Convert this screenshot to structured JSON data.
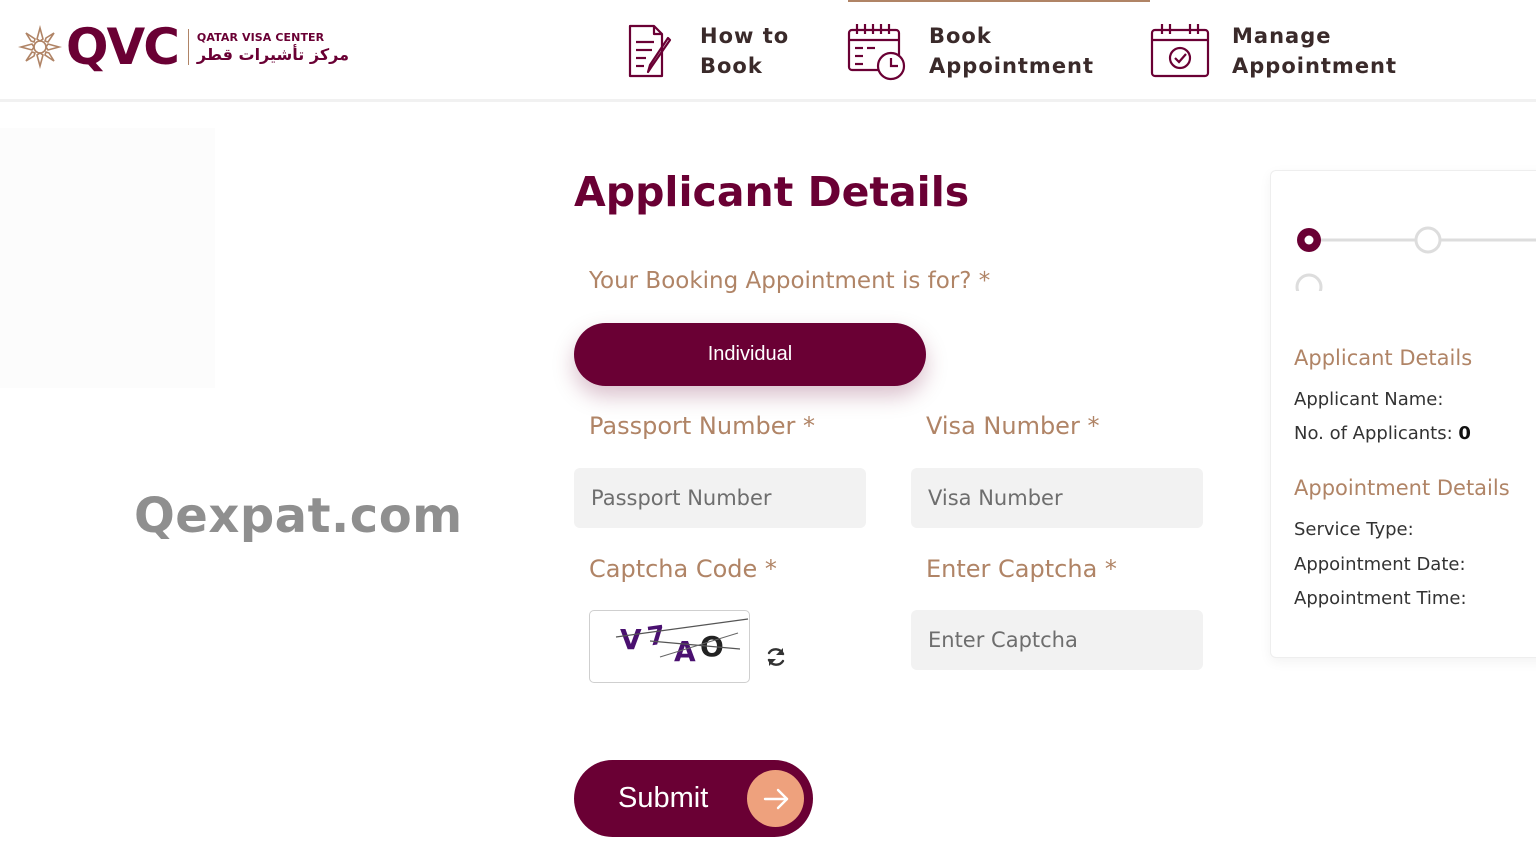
{
  "header": {
    "brand": "QVC",
    "brand_sub_en": "QATAR VISA CENTER",
    "brand_sub_ar": "مركز تأشيرات قطر",
    "nav": [
      {
        "line1": "How to",
        "line2": "Book"
      },
      {
        "line1": "Book",
        "line2": "Appointment"
      },
      {
        "line1": "Manage",
        "line2": "Appointment"
      }
    ]
  },
  "watermark": "Qexpat.com",
  "form": {
    "title": "Applicant Details",
    "question": "Your Booking Appointment is for? *",
    "individual_label": "Individual",
    "passport_label": "Passport Number *",
    "passport_placeholder": "Passport Number",
    "visa_label": "Visa Number *",
    "visa_placeholder": "Visa Number",
    "captcha_label": "Captcha Code *",
    "captcha_text": "V7AO",
    "enter_captcha_label": "Enter Captcha *",
    "enter_captcha_placeholder": "Enter Captcha",
    "submit_label": "Submit"
  },
  "summary": {
    "applicant_heading": "Applicant Details",
    "applicant_name_label": "Applicant Name:",
    "applicant_name_value": "",
    "num_applicants_label": "No. of Applicants:",
    "num_applicants_value": "0",
    "appointment_heading": "Appointment Details",
    "service_type_label": "Service Type:",
    "appointment_date_label": "Appointment Date:",
    "appointment_time_label": "Appointment Time:",
    "current_step": 1
  },
  "colors": {
    "primary": "#6a0034",
    "accent": "#b08466",
    "arrow_circle": "#eea17d",
    "input_bg": "#f2f2f2"
  },
  "icons": [
    "qvc-emblem-icon",
    "how-to-book-icon",
    "book-appointment-icon",
    "manage-appointment-icon",
    "refresh-icon",
    "arrow-right-icon"
  ]
}
